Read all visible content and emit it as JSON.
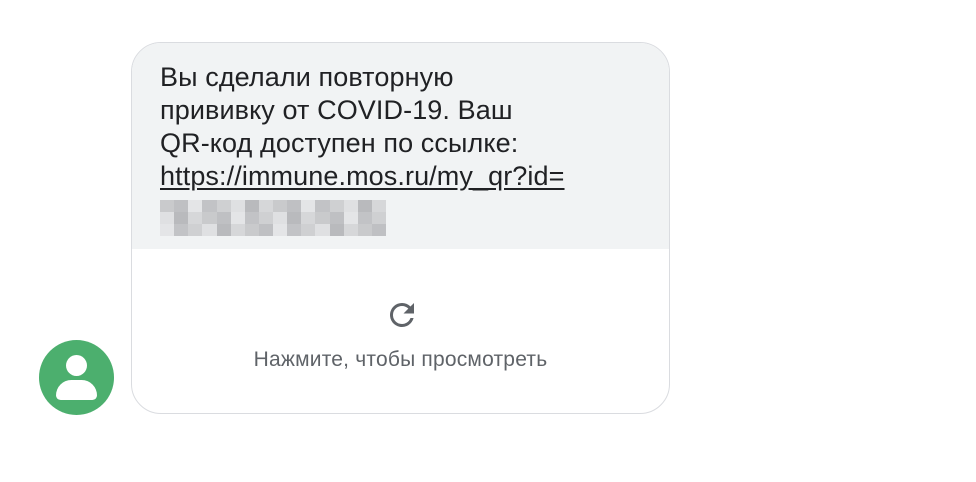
{
  "contact": {
    "avatar_icon": "person-icon",
    "avatar_color": "#4caf6e"
  },
  "message": {
    "lines": [
      "Вы сделали повторную",
      "прививку от COVID-19. Ваш",
      "QR-код доступен по ссылке:"
    ],
    "link_text": "https://immune.mos.ru/my_qr?id=",
    "redacted_id": true
  },
  "preview": {
    "icon": "refresh-icon",
    "label": "Нажмите, чтобы просмотреть"
  },
  "colors": {
    "bubble_bg": "#f1f3f4",
    "bubble_border": "#dadce0",
    "text": "#202124",
    "secondary_text": "#5f6368"
  }
}
